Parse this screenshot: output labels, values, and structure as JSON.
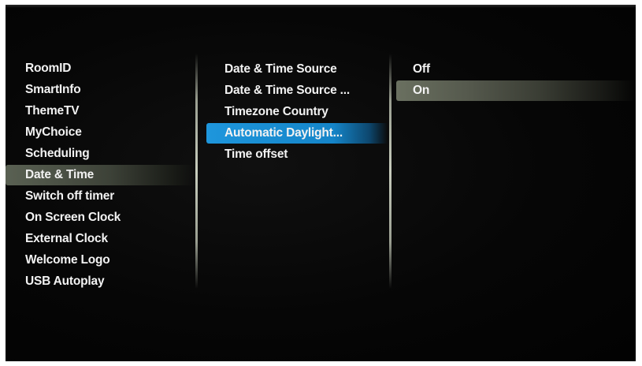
{
  "col1": {
    "items": [
      {
        "label": "RoomID"
      },
      {
        "label": "SmartInfo"
      },
      {
        "label": "ThemeTV"
      },
      {
        "label": "MyChoice"
      },
      {
        "label": "Scheduling"
      },
      {
        "label": "Date & Time"
      },
      {
        "label": "Switch off timer"
      },
      {
        "label": "On Screen Clock"
      },
      {
        "label": "External Clock"
      },
      {
        "label": "Welcome Logo"
      },
      {
        "label": "USB Autoplay"
      }
    ],
    "selected_index": 5
  },
  "col2": {
    "items": [
      {
        "label": "Date & Time Source"
      },
      {
        "label": "Date & Time Source ..."
      },
      {
        "label": "Timezone Country"
      },
      {
        "label": "Automatic Daylight..."
      },
      {
        "label": "Time offset"
      }
    ],
    "focused_index": 3
  },
  "col3": {
    "items": [
      {
        "label": "Off"
      },
      {
        "label": "On"
      }
    ],
    "selected_index": 1
  },
  "colors": {
    "focus": "#1e96dc",
    "selected": "#5a6153",
    "text": "#f2f2f2",
    "background": "#060606"
  }
}
